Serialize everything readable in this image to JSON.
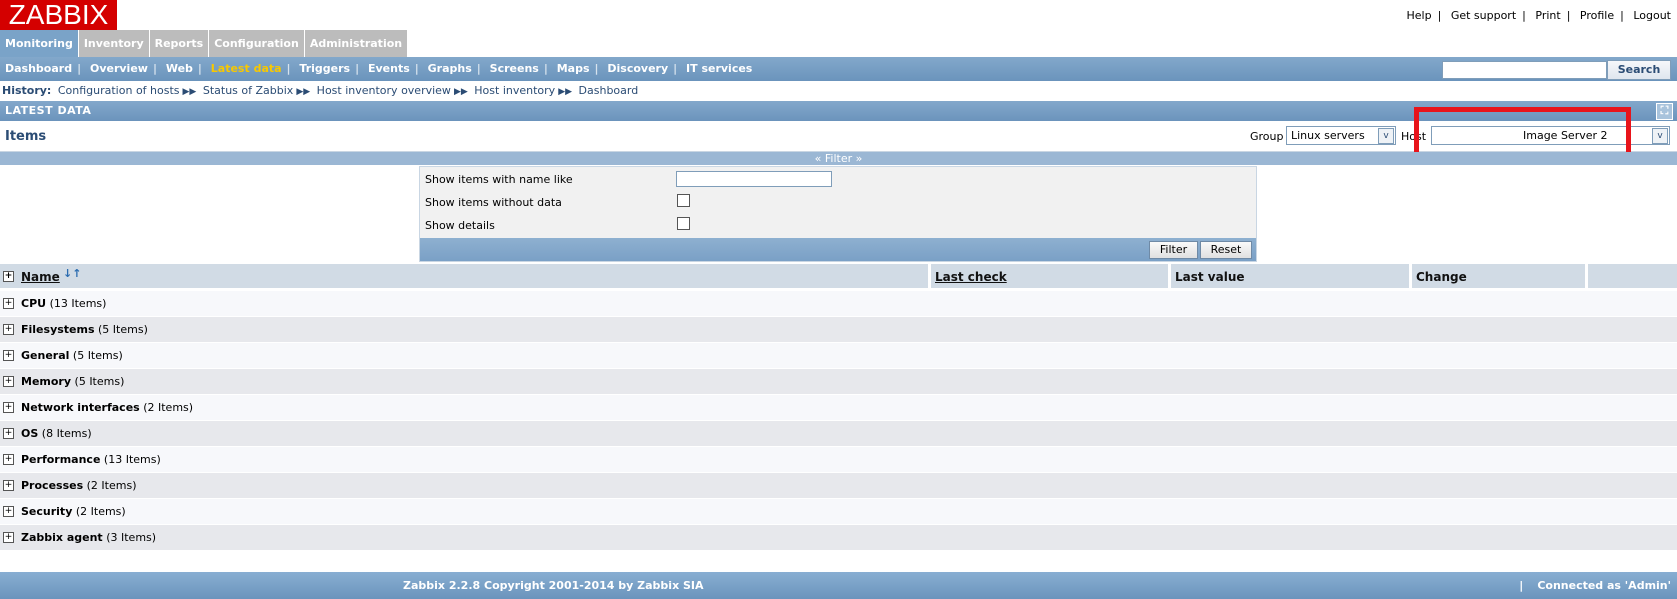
{
  "logo": "ZABBIX",
  "top_links": [
    "Help",
    "Get support",
    "Print",
    "Profile",
    "Logout"
  ],
  "main_menu": [
    "Monitoring",
    "Inventory",
    "Reports",
    "Configuration",
    "Administration"
  ],
  "sub_menu": [
    "Dashboard",
    "Overview",
    "Web",
    "Latest data",
    "Triggers",
    "Events",
    "Graphs",
    "Screens",
    "Maps",
    "Discovery",
    "IT services"
  ],
  "active_sub": "Latest data",
  "search": {
    "value": "",
    "button": "Search"
  },
  "history": {
    "label": "History:",
    "items": [
      "Configuration of hosts",
      "Status of Zabbix",
      "Host inventory overview",
      "Host inventory",
      "Dashboard"
    ]
  },
  "section_title": "LATEST DATA",
  "items_bar": {
    "title": "Items",
    "group_label": "Group",
    "group_value": "Linux servers",
    "host_label": "Host",
    "host_value": "Image Server 2"
  },
  "filter": {
    "toggle_label": "« Filter »",
    "name_like_label": "Show items with name like",
    "name_like_value": "",
    "without_data_label": "Show items without data",
    "details_label": "Show details",
    "filter_button": "Filter",
    "reset_button": "Reset"
  },
  "table": {
    "headers": {
      "name": "Name",
      "last_check": "Last check",
      "last_value": "Last value",
      "change": "Change"
    },
    "rows": [
      {
        "name": "CPU",
        "count": "(13 Items)"
      },
      {
        "name": "Filesystems",
        "count": "(5 Items)"
      },
      {
        "name": "General",
        "count": "(5 Items)"
      },
      {
        "name": "Memory",
        "count": "(5 Items)"
      },
      {
        "name": "Network interfaces",
        "count": "(2 Items)"
      },
      {
        "name": "OS",
        "count": "(8 Items)"
      },
      {
        "name": "Performance",
        "count": "(13 Items)"
      },
      {
        "name": "Processes",
        "count": "(2 Items)"
      },
      {
        "name": "Security",
        "count": "(2 Items)"
      },
      {
        "name": "Zabbix agent",
        "count": "(3 Items)"
      }
    ]
  },
  "footer": {
    "copyright": "Zabbix 2.2.8 Copyright 2001-2014 by Zabbix SIA",
    "connected": "Connected as 'Admin'"
  },
  "colors": {
    "logo_bg": "#d40000",
    "header_blue": "#6b94bc",
    "active_sub": "#f8c800",
    "highlight": "#e8141b"
  }
}
